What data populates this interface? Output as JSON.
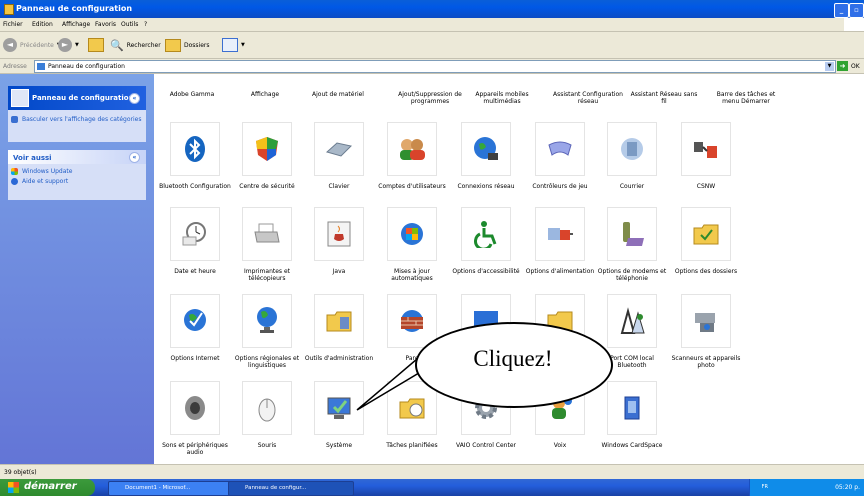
{
  "window": {
    "title": "Panneau de configuration"
  },
  "menubar": [
    "Fichier",
    "Edition",
    "Affichage",
    "Favoris",
    "Outils",
    "?"
  ],
  "toolbar": {
    "back": "Précédente",
    "search": "Rechercher",
    "folders": "Dossiers"
  },
  "address": {
    "label": "Adresse",
    "value": "Panneau de configuration",
    "go": "OK"
  },
  "sidebar": {
    "panel1": {
      "title": "Panneau de configuration",
      "link": "Basculer vers l'affichage des catégories"
    },
    "panel2": {
      "title": "Voir aussi",
      "links": [
        "Windows Update",
        "Aide et support"
      ]
    }
  },
  "top_labels": [
    "Adobe Gamma",
    "Affichage",
    "Ajout de matériel",
    "Ajout/Suppression de programmes",
    "Appareils mobiles multimédias",
    "Assistant Configuration réseau",
    "Assistant Réseau sans fil",
    "Barre des tâches et menu Démarrer"
  ],
  "items": [
    [
      "Bluetooth Configuration",
      "Centre de sécurité",
      "Clavier",
      "Comptes d'utilisateurs",
      "Connexions réseau",
      "Contrôleurs de jeu",
      "Courrier",
      "CSNW"
    ],
    [
      "Date et heure",
      "Imprimantes et télécopieurs",
      "Java",
      "Mises à jour automatiques",
      "Options d'accessibilité",
      "Options d'alimentation",
      "Options de modems et téléphonie",
      "Options des dossiers"
    ],
    [
      "Options Internet",
      "Options régionales et linguistiques",
      "Outils d'administration",
      "Pare",
      "",
      "",
      "Port COM local Bluetooth",
      "Scanneurs et appareils photo"
    ],
    [
      "Sons et périphériques audio",
      "Souris",
      "Système",
      "Tâches planifiées",
      "VAIO Control Center",
      "Voix",
      "Windows CardSpace",
      ""
    ]
  ],
  "status": "39 objet(s)",
  "taskbar": {
    "start": "démarrer",
    "tasks": [
      "Document1 - Microsof...",
      "Panneau de configur..."
    ],
    "time": "05:20 p.",
    "lang": "FR"
  },
  "callout": "Cliquez!"
}
